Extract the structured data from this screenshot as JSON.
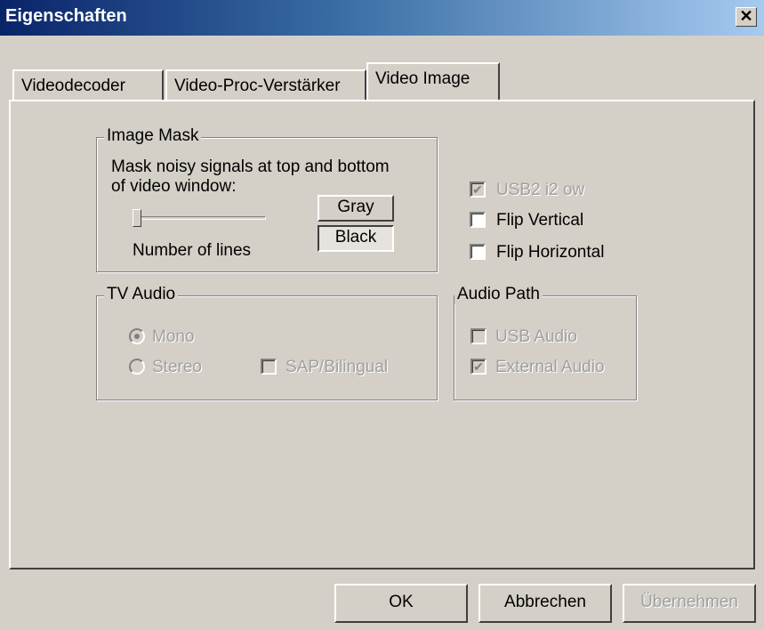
{
  "window": {
    "title": "Eigenschaften"
  },
  "tabs": [
    {
      "label": "Videodecoder"
    },
    {
      "label": "Video-Proc-Verstärker"
    },
    {
      "label": "Video Image"
    }
  ],
  "image_mask": {
    "legend": "Image Mask",
    "description_line1": "Mask noisy signals at top and bottom",
    "description_line2": "of video window:",
    "gray_label": "Gray",
    "black_label": "Black",
    "slider_label": "Number of lines",
    "slider_value": 0
  },
  "options": {
    "usb2_label": "USB2  i2 ow",
    "usb2_checked": true,
    "flip_vertical_label": "Flip Vertical",
    "flip_vertical_checked": false,
    "flip_horizontal_label": "Flip Horizontal",
    "flip_horizontal_checked": false
  },
  "tv_audio": {
    "legend": "TV Audio",
    "mono_label": "Mono",
    "stereo_label": "Stereo",
    "sap_label": "SAP/Bilingual",
    "selected": "Mono"
  },
  "audio_path": {
    "legend": "Audio Path",
    "usb_audio_label": "USB Audio",
    "external_audio_label": "External Audio",
    "external_audio_checked": true
  },
  "footer": {
    "ok_label": "OK",
    "cancel_label": "Abbrechen",
    "apply_label": "Übernehmen"
  }
}
